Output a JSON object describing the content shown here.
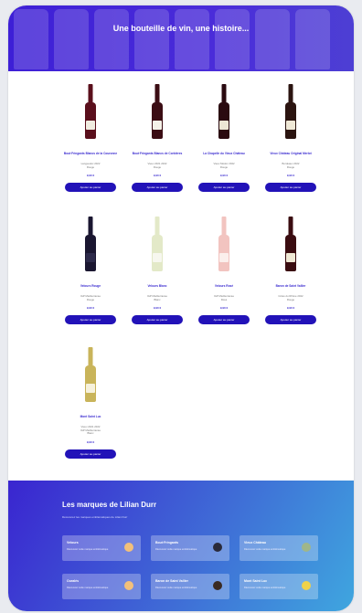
{
  "hero": {
    "title": "Une bouteille de vin, une histoire..."
  },
  "products": [
    {
      "name": "Bout·Fringants Blancs de la Couronne",
      "details": [
        "Languedoc 2022",
        "Rouge"
      ],
      "price": "9,90 €",
      "button": "Ajouter au panier",
      "bottle": "#5a0f1c",
      "label": "#f0ece0"
    },
    {
      "name": "Bout·Fringants Blancs de Corbières",
      "details": [
        "Vieux 2021 2022",
        "Rouge"
      ],
      "price": "9,90 €",
      "button": "Ajouter au panier",
      "bottle": "#3b0d14",
      "label": "#f4f1e8"
    },
    {
      "name": "La Chapelle du Vieux Château",
      "details": [
        "Vieux Médoc 2022",
        "Rouge"
      ],
      "price": "9,90 €",
      "button": "Ajouter au panier",
      "bottle": "#2a0a10",
      "label": "#ece6d4"
    },
    {
      "name": "Vieux Château Original Merlot",
      "details": [
        "Bordeaux 2022",
        "Rouge"
      ],
      "price": "9,90 €",
      "button": "Ajouter au panier",
      "bottle": "#2b1410",
      "label": "#efe8d6"
    },
    {
      "name": "Velours Rouge",
      "details": [
        "IGP Méditerranée",
        "Rouge"
      ],
      "price": "9,90 €",
      "button": "Ajouter au panier",
      "bottle": "#1a1630",
      "label": "#2d2a4a"
    },
    {
      "name": "Velours Blanc",
      "details": [
        "IGP Méditerranée",
        "Blanc"
      ],
      "price": "9,90 €",
      "button": "Ajouter au panier",
      "bottle": "#e3e9c8",
      "label": "#f7f7ef"
    },
    {
      "name": "Velours Rosé",
      "details": [
        "IGP Méditerranée",
        "Rosé"
      ],
      "price": "9,90 €",
      "button": "Ajouter au panier",
      "bottle": "#f2c4c0",
      "label": "#fbefec"
    },
    {
      "name": "Baron de Saint Vallier",
      "details": [
        "Côtes du Rhône 2022",
        "Rouge"
      ],
      "price": "9,90 €",
      "button": "Ajouter au panier",
      "bottle": "#3a0c10",
      "label": "#efe8d4"
    },
    {
      "name": "Mont Saint Luc",
      "details": [
        "Vieux 2021 2022",
        "IGP Méditerranée",
        "Blanc"
      ],
      "price": "9,90 €",
      "button": "Ajouter au panier",
      "bottle": "#c9b45a",
      "label": "#f6f1dc"
    }
  ],
  "brands": {
    "title": "Les marques de Lilian Durr",
    "subtitle": "Découvrez les marques emblématiques de Lilian Durr",
    "items": [
      {
        "name": "Velours",
        "desc": "Découvrez cette marque emblématique",
        "icon_color": "#f3c07a"
      },
      {
        "name": "Bout·Fringants",
        "desc": "Découvrez cette marque emblématique",
        "icon_color": "#2a2a3a"
      },
      {
        "name": "Vieux Château",
        "desc": "Découvrez cette marque emblématique",
        "icon_color": "#9fb68a"
      },
      {
        "name": "Ouralés",
        "desc": "Découvrez cette marque emblématique",
        "icon_color": "#f3c07a"
      },
      {
        "name": "Baron de Saint Vallier",
        "desc": "Découvrez cette marque emblématique",
        "icon_color": "#3a2a22"
      },
      {
        "name": "Mont Saint Luc",
        "desc": "Découvrez cette marque emblématique",
        "icon_color": "#f0d24a"
      }
    ]
  }
}
